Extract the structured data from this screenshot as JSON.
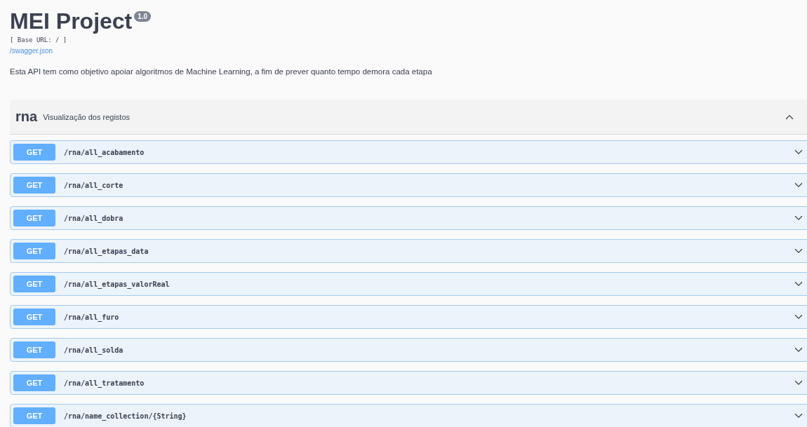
{
  "info": {
    "title": "MEI Project",
    "version": "1.0",
    "base_url": "[ Base URL: / ]",
    "spec_link": "/swagger.json",
    "description": "Esta API tem como objetivo apoiar algoritmos de Machine Learning, a fim de prever quanto tempo demora cada etapa"
  },
  "tag": {
    "name": "rna",
    "description": "Visualização dos registos",
    "expanded": true
  },
  "operations": [
    {
      "method": "GET",
      "path": "/rna/all_acabamento",
      "expanded": false
    },
    {
      "method": "GET",
      "path": "/rna/all_corte",
      "expanded": false
    },
    {
      "method": "GET",
      "path": "/rna/all_dobra",
      "expanded": false
    },
    {
      "method": "GET",
      "path": "/rna/all_etapas_data",
      "expanded": false
    },
    {
      "method": "GET",
      "path": "/rna/all_etapas_valorReal",
      "expanded": false
    },
    {
      "method": "GET",
      "path": "/rna/all_furo",
      "expanded": false
    },
    {
      "method": "GET",
      "path": "/rna/all_solda",
      "expanded": false
    },
    {
      "method": "GET",
      "path": "/rna/all_tratamento",
      "expanded": false
    },
    {
      "method": "GET",
      "path": "/rna/name_collection/{String}",
      "expanded": false
    }
  ]
}
